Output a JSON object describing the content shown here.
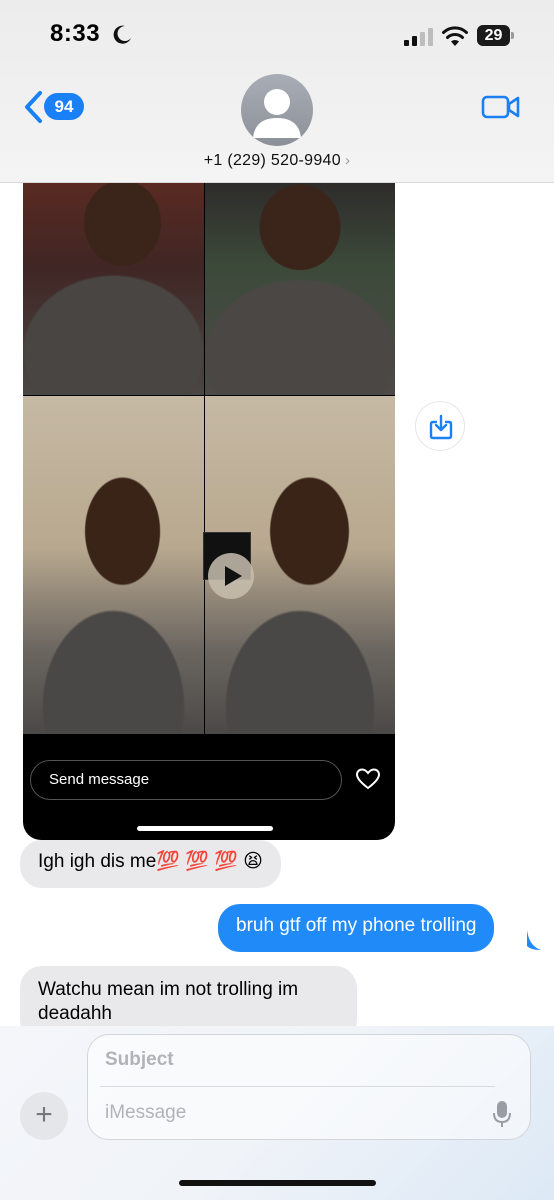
{
  "status_bar": {
    "time": "8:33",
    "battery": "29",
    "icons": [
      "moon-icon",
      "signal-icon",
      "wifi-icon",
      "battery-icon"
    ]
  },
  "header": {
    "back_count": "94",
    "contact": "+1 (229) 520-9940",
    "contact_chevron": "›",
    "icons": [
      "back-chevron-icon",
      "avatar-icon",
      "video-camera-icon"
    ],
    "accent": "#1a80f5"
  },
  "media": {
    "send_placeholder": "Send message",
    "icons": [
      "play-icon",
      "heart-icon",
      "save-download-icon"
    ]
  },
  "messages": [
    {
      "direction": "incoming",
      "text": "Igh igh dis me💯 💯 💯 😫"
    },
    {
      "direction": "outgoing",
      "text": "bruh gtf off my phone trolling"
    },
    {
      "direction": "incoming",
      "text": "Watchu mean im not trolling im deadahh"
    }
  ],
  "composer": {
    "plus": "+",
    "subject_placeholder": "Subject",
    "message_placeholder": "iMessage",
    "icons": [
      "plus-icon",
      "microphone-icon"
    ]
  },
  "colors": {
    "incoming_bubble": "#e9e9eb",
    "outgoing_bubble": "#1f8af8"
  }
}
